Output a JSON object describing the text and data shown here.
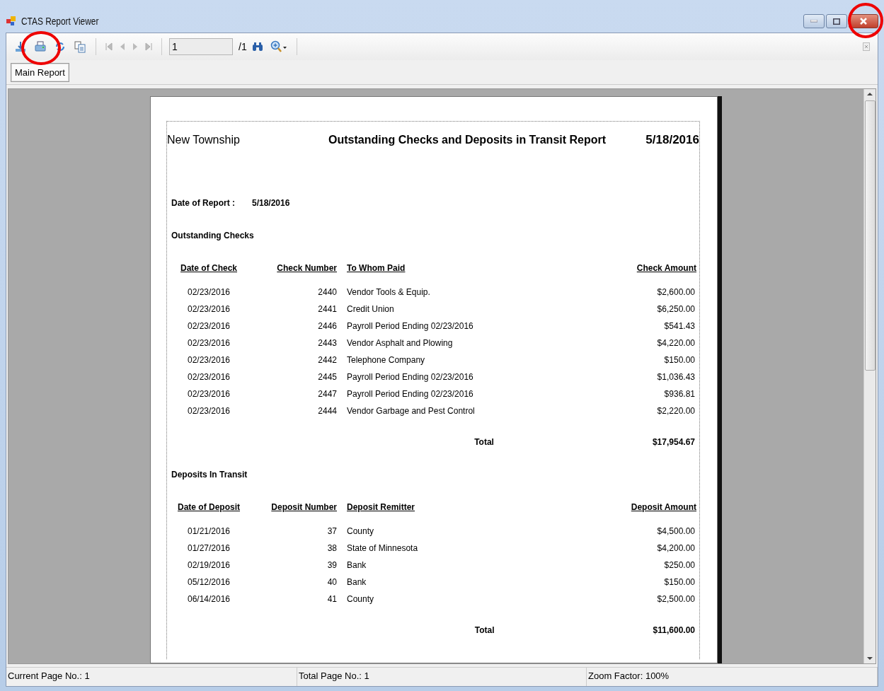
{
  "window": {
    "title": "CTAS Report Viewer"
  },
  "toolbar": {
    "page_input": "1",
    "page_total": "/1"
  },
  "tabs": [
    {
      "label": "Main Report",
      "selected": true
    }
  ],
  "report": {
    "organization": "New Township",
    "title": "Outstanding Checks and Deposits in Transit Report",
    "date": "5/18/2016",
    "date_of_report_label": "Date of Report :",
    "date_of_report": "5/18/2016",
    "sections": [
      {
        "heading": "Outstanding Checks",
        "columns": [
          "Date of Check",
          "Check Number",
          "To Whom Paid",
          "Check Amount"
        ],
        "rows": [
          [
            "02/23/2016",
            "2440",
            "Vendor Tools & Equip.",
            "$2,600.00"
          ],
          [
            "02/23/2016",
            "2441",
            "Credit Union",
            "$6,250.00"
          ],
          [
            "02/23/2016",
            "2446",
            "Payroll Period Ending 02/23/2016",
            "$541.43"
          ],
          [
            "02/23/2016",
            "2443",
            "Vendor Asphalt and Plowing",
            "$4,220.00"
          ],
          [
            "02/23/2016",
            "2442",
            "Telephone Company",
            "$150.00"
          ],
          [
            "02/23/2016",
            "2445",
            "Payroll Period Ending 02/23/2016",
            "$1,036.43"
          ],
          [
            "02/23/2016",
            "2447",
            "Payroll Period Ending 02/23/2016",
            "$936.81"
          ],
          [
            "02/23/2016",
            "2444",
            "Vendor Garbage and Pest Control",
            "$2,220.00"
          ]
        ],
        "total_label": "Total",
        "total": "$17,954.67"
      },
      {
        "heading": "Deposits In Transit",
        "columns": [
          "Date of Deposit",
          "Deposit Number",
          "Deposit Remitter",
          "Deposit Amount"
        ],
        "rows": [
          [
            "01/21/2016",
            "37",
            "County",
            "$4,500.00"
          ],
          [
            "01/27/2016",
            "38",
            "State of Minnesota",
            "$4,200.00"
          ],
          [
            "02/19/2016",
            "39",
            "Bank",
            "$250.00"
          ],
          [
            "05/12/2016",
            "40",
            "Bank",
            "$150.00"
          ],
          [
            "06/14/2016",
            "41",
            "County",
            "$2,500.00"
          ]
        ],
        "total_label": "Total",
        "total": "$11,600.00"
      }
    ]
  },
  "status_bar": [
    "Current Page No.: 1",
    "Total Page No.: 1",
    "Zoom Factor: 100%"
  ]
}
